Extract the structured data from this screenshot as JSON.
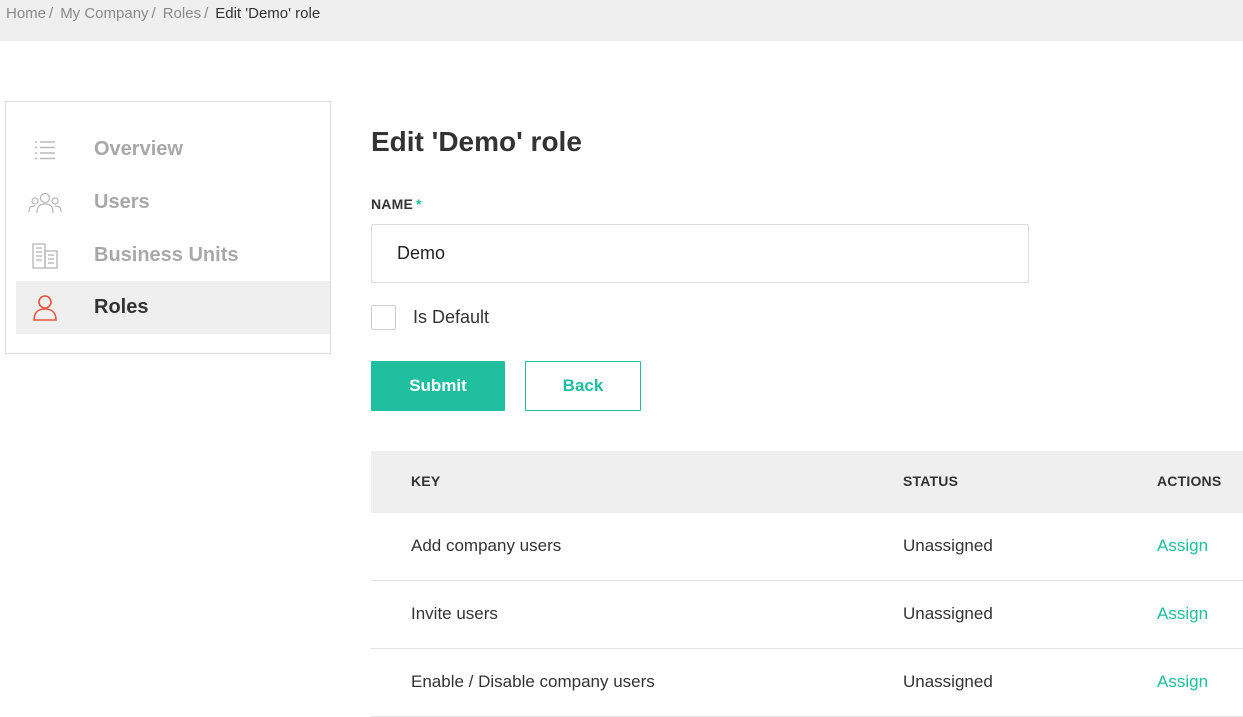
{
  "breadcrumb": {
    "items": [
      "Home",
      "My Company",
      "Roles"
    ],
    "separator": "/",
    "current": "Edit 'Demo' role"
  },
  "sidebar": {
    "items": [
      {
        "label": "Overview",
        "icon": "list-icon",
        "active": false
      },
      {
        "label": "Users",
        "icon": "users-icon",
        "active": false
      },
      {
        "label": "Business Units",
        "icon": "building-icon",
        "active": false
      },
      {
        "label": "Roles",
        "icon": "user-icon",
        "active": true
      }
    ]
  },
  "form": {
    "title": "Edit 'Demo' role",
    "name_label": "NAME",
    "required_mark": "*",
    "name_value": "Demo",
    "is_default_label": "Is Default",
    "is_default_checked": false,
    "submit_label": "Submit",
    "back_label": "Back"
  },
  "table": {
    "headers": {
      "key": "KEY",
      "status": "STATUS",
      "actions": "ACTIONS"
    },
    "rows": [
      {
        "key": "Add company users",
        "status": "Unassigned",
        "action": "Assign"
      },
      {
        "key": "Invite users",
        "status": "Unassigned",
        "action": "Assign"
      },
      {
        "key": "Enable / Disable company users",
        "status": "Unassigned",
        "action": "Assign"
      }
    ]
  },
  "colors": {
    "accent": "#1fbf9f",
    "active_icon": "#e8553e",
    "muted": "#a8a8a8"
  }
}
